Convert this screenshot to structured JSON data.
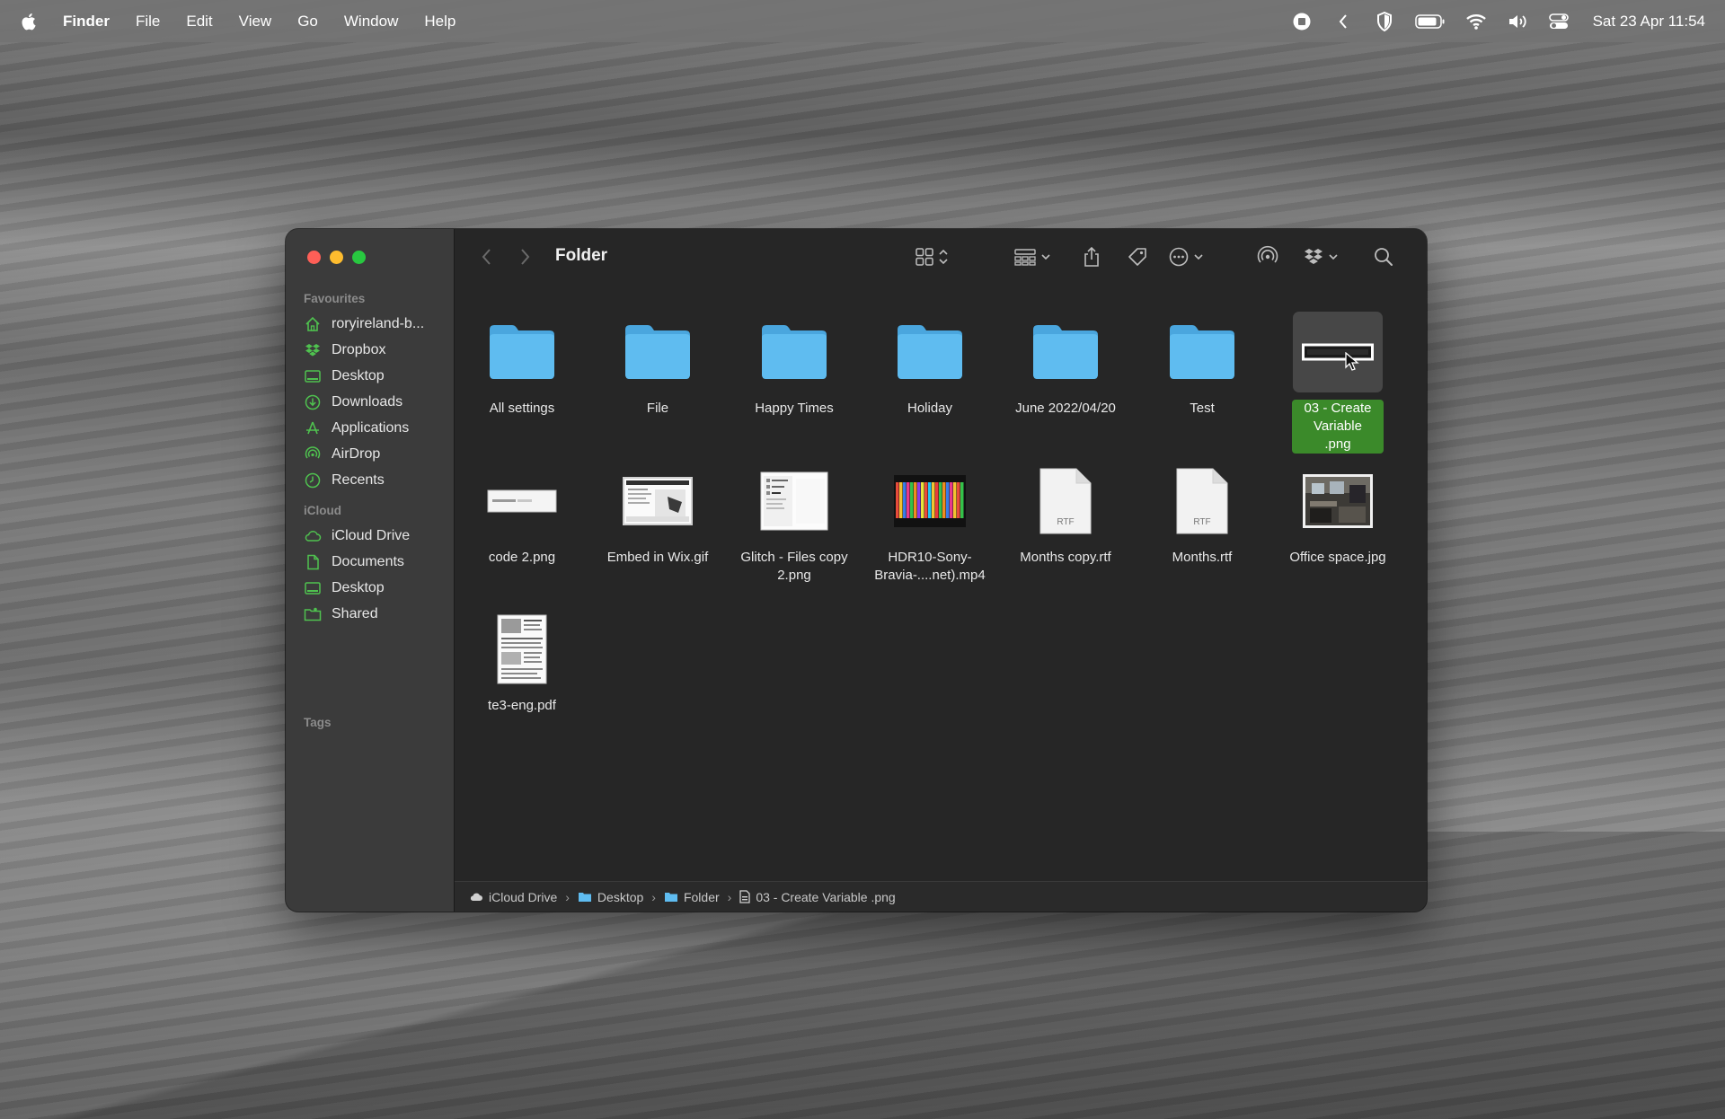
{
  "menubar": {
    "app_name": "Finder",
    "menus": [
      "File",
      "Edit",
      "View",
      "Go",
      "Window",
      "Help"
    ],
    "status_icons": [
      "screen-record-icon",
      "chevron-left-icon",
      "shield-icon",
      "battery-icon",
      "wifi-icon",
      "volume-icon",
      "control-center-icon"
    ],
    "clock": "Sat 23 Apr  11:54"
  },
  "sidebar": {
    "favourites_heading": "Favourites",
    "favourites": [
      {
        "label": "roryireland-b...",
        "icon": "home-icon"
      },
      {
        "label": "Dropbox",
        "icon": "dropbox-icon"
      },
      {
        "label": "Desktop",
        "icon": "desktop-icon"
      },
      {
        "label": "Downloads",
        "icon": "downloads-icon"
      },
      {
        "label": "Applications",
        "icon": "applications-icon"
      },
      {
        "label": "AirDrop",
        "icon": "airdrop-icon"
      },
      {
        "label": "Recents",
        "icon": "recents-icon"
      }
    ],
    "icloud_heading": "iCloud",
    "icloud": [
      {
        "label": "iCloud Drive",
        "icon": "cloud-icon"
      },
      {
        "label": "Documents",
        "icon": "document-icon"
      },
      {
        "label": "Desktop",
        "icon": "desktop-icon"
      },
      {
        "label": "Shared",
        "icon": "shared-folder-icon"
      }
    ],
    "tags_heading": "Tags"
  },
  "toolbar": {
    "title": "Folder"
  },
  "files": [
    {
      "name": "All settings",
      "kind": "folder"
    },
    {
      "name": "File",
      "kind": "folder"
    },
    {
      "name": "Happy Times",
      "kind": "folder"
    },
    {
      "name": "Holiday",
      "kind": "folder"
    },
    {
      "name": "June 2022/04/20",
      "kind": "folder"
    },
    {
      "name": "Test",
      "kind": "folder"
    },
    {
      "name": "03 - Create Variable .png",
      "kind": "image-selected"
    },
    {
      "name": "code 2.png",
      "kind": "image-code"
    },
    {
      "name": "Embed in Wix.gif",
      "kind": "image-screenshot"
    },
    {
      "name": "Glitch - Files copy 2.png",
      "kind": "image-menu"
    },
    {
      "name": "HDR10-Sony-Bravia-....net).mp4",
      "kind": "video"
    },
    {
      "name": "Months copy.rtf",
      "kind": "rtf",
      "badge": "RTF"
    },
    {
      "name": "Months.rtf",
      "kind": "rtf",
      "badge": "RTF"
    },
    {
      "name": "Office space.jpg",
      "kind": "photo"
    },
    {
      "name": "te3-eng.pdf",
      "kind": "pdf"
    }
  ],
  "pathbar": {
    "crumbs": [
      "iCloud Drive",
      "Desktop",
      "Folder",
      "03 - Create Variable .png"
    ]
  },
  "colors": {
    "accent": "#3b8a2a",
    "folder": "#5fbcf0",
    "sidebar_icon": "#4fc24f"
  }
}
